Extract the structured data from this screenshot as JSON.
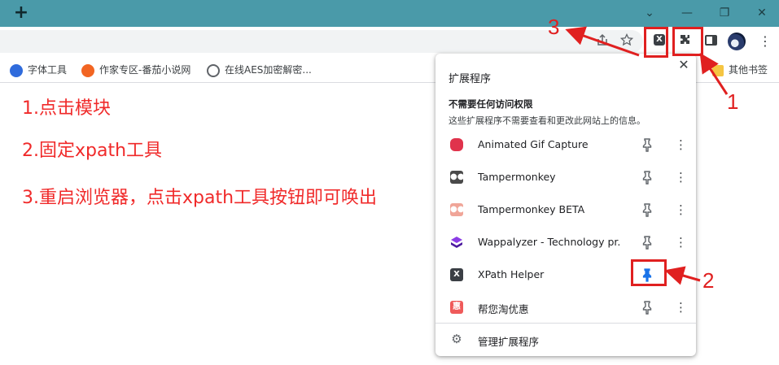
{
  "window": {
    "newtab_glyph": "+",
    "minimize_glyph": "—",
    "restore_glyph": "❐",
    "close_glyph": "✕",
    "dropdown_glyph": "⌄"
  },
  "toolbar": {
    "share_icon": "share-icon",
    "star_icon": "bookmark-star-icon",
    "ext_x_label": "X",
    "puzzle_glyph": "✱",
    "menu_glyph": "⋮"
  },
  "bookmarks": [
    {
      "label": "字体工具",
      "icon": "baidu-paw-icon",
      "color": "#2f6bdc"
    },
    {
      "label": "作家专区-番茄小说网",
      "icon": "tomato-icon",
      "color": "#f26522"
    },
    {
      "label": "在线AES加密解密...",
      "icon": "globe-icon",
      "color": "#5f6368"
    },
    {
      "label": "其他书签",
      "icon": "folder-icon",
      "color": "#f5c542"
    }
  ],
  "notes": [
    "1.点击模块",
    "2.固定xpath工具",
    "3.重启浏览器，点击xpath工具按钮即可唤出"
  ],
  "annotations": {
    "label1": "1",
    "label2": "2",
    "label3": "3"
  },
  "popup": {
    "title": "扩展程序",
    "section_title": "不需要任何访问权限",
    "section_sub": "这些扩展程序不需要查看和更改此网站上的信息。",
    "extensions": [
      {
        "name": "Animated Gif Capture",
        "icon": "gif-capture-icon",
        "color": "#e0334c",
        "pinned": false
      },
      {
        "name": "Tampermonkey",
        "icon": "tampermonkey-icon",
        "color": "#4a4a4a",
        "pinned": false
      },
      {
        "name": "Tampermonkey BETA",
        "icon": "tampermonkey-beta-icon",
        "color": "#f0a598",
        "pinned": false
      },
      {
        "name": "Wappalyzer - Technology pr...",
        "icon": "wappalyzer-icon",
        "color": "#6a1fc2",
        "pinned": false
      },
      {
        "name": "XPath Helper",
        "icon": "xpath-icon",
        "color": "#3b3f45",
        "pinned": true
      },
      {
        "name": "帮您淘优惠",
        "icon": "coupon-icon",
        "color": "#ef5a5a",
        "pinned": false
      }
    ],
    "manage_label": "管理扩展程序"
  },
  "colors": {
    "titlebar": "#4a9aa9",
    "annotation_red": "#e02020",
    "pin_active": "#1a73e8"
  }
}
